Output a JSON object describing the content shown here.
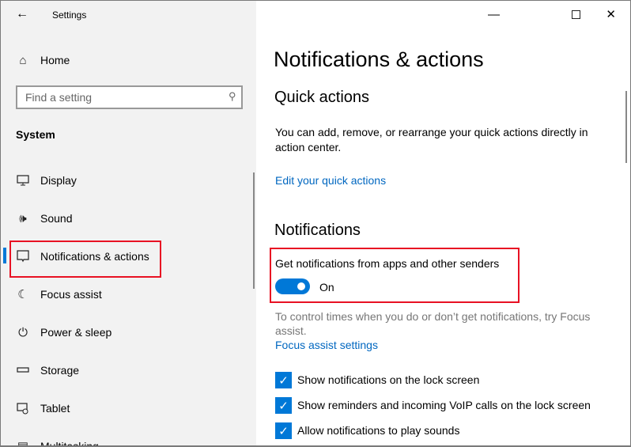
{
  "window": {
    "title": "Settings",
    "minimize": "—",
    "maximize": "☐",
    "close": "✕"
  },
  "sidebar": {
    "home": "Home",
    "search_placeholder": "Find a setting",
    "section": "System",
    "items": [
      {
        "label": "Display",
        "icon": "display-icon"
      },
      {
        "label": "Sound",
        "icon": "sound-icon"
      },
      {
        "label": "Notifications & actions",
        "icon": "notifications-icon",
        "selected": true
      },
      {
        "label": "Focus assist",
        "icon": "moon-icon"
      },
      {
        "label": "Power & sleep",
        "icon": "power-icon"
      },
      {
        "label": "Storage",
        "icon": "storage-icon"
      },
      {
        "label": "Tablet",
        "icon": "tablet-icon"
      },
      {
        "label": "Multitasking",
        "icon": "multitasking-icon"
      }
    ]
  },
  "main": {
    "title": "Notifications & actions",
    "quick_actions": {
      "heading": "Quick actions",
      "description": "You can add, remove, or rearrange your quick actions directly in action center.",
      "link": "Edit your quick actions"
    },
    "notifications": {
      "heading": "Notifications",
      "toggle_label": "Get notifications from apps and other senders",
      "toggle_state": "On",
      "focus_text": "To control times when you do or don’t get notifications, try Focus assist.",
      "focus_link": "Focus assist settings",
      "checkboxes": [
        {
          "label": "Show notifications on the lock screen",
          "checked": true
        },
        {
          "label": "Show reminders and incoming VoIP calls on the lock screen",
          "checked": true
        },
        {
          "label": "Allow notifications to play sounds",
          "checked": true
        }
      ]
    }
  },
  "colors": {
    "accent": "#0078d7",
    "highlight": "#e81123",
    "link": "#0067c0"
  }
}
